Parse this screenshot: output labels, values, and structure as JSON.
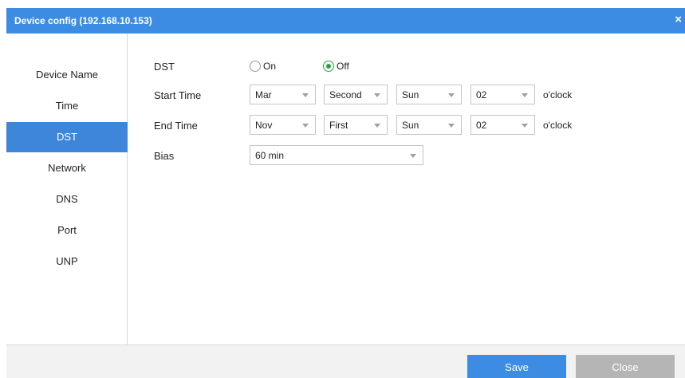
{
  "window": {
    "title": "Device config (192.168.10.153)",
    "close_glyph": "×"
  },
  "sidebar": {
    "items": [
      {
        "label": "Device Name",
        "active": false
      },
      {
        "label": "Time",
        "active": false
      },
      {
        "label": "DST",
        "active": true
      },
      {
        "label": "Network",
        "active": false
      },
      {
        "label": "DNS",
        "active": false
      },
      {
        "label": "Port",
        "active": false
      },
      {
        "label": "UNP",
        "active": false
      }
    ]
  },
  "form": {
    "dst": {
      "label": "DST",
      "on_label": "On",
      "off_label": "Off",
      "selected": "Off"
    },
    "start_time": {
      "label": "Start Time",
      "month": "Mar",
      "week": "Second",
      "day": "Sun",
      "hour": "02",
      "suffix": "o'clock"
    },
    "end_time": {
      "label": "End Time",
      "month": "Nov",
      "week": "First",
      "day": "Sun",
      "hour": "02",
      "suffix": "o'clock"
    },
    "bias": {
      "label": "Bias",
      "value": "60 min"
    }
  },
  "footer": {
    "save_label": "Save",
    "close_label": "Close"
  },
  "colors": {
    "titlebar": "#3d8ce3",
    "active_nav": "#3d86d9",
    "radio_checked": "#27a33d",
    "save_button": "#3d8ce3",
    "close_button": "#b5b5b5"
  }
}
